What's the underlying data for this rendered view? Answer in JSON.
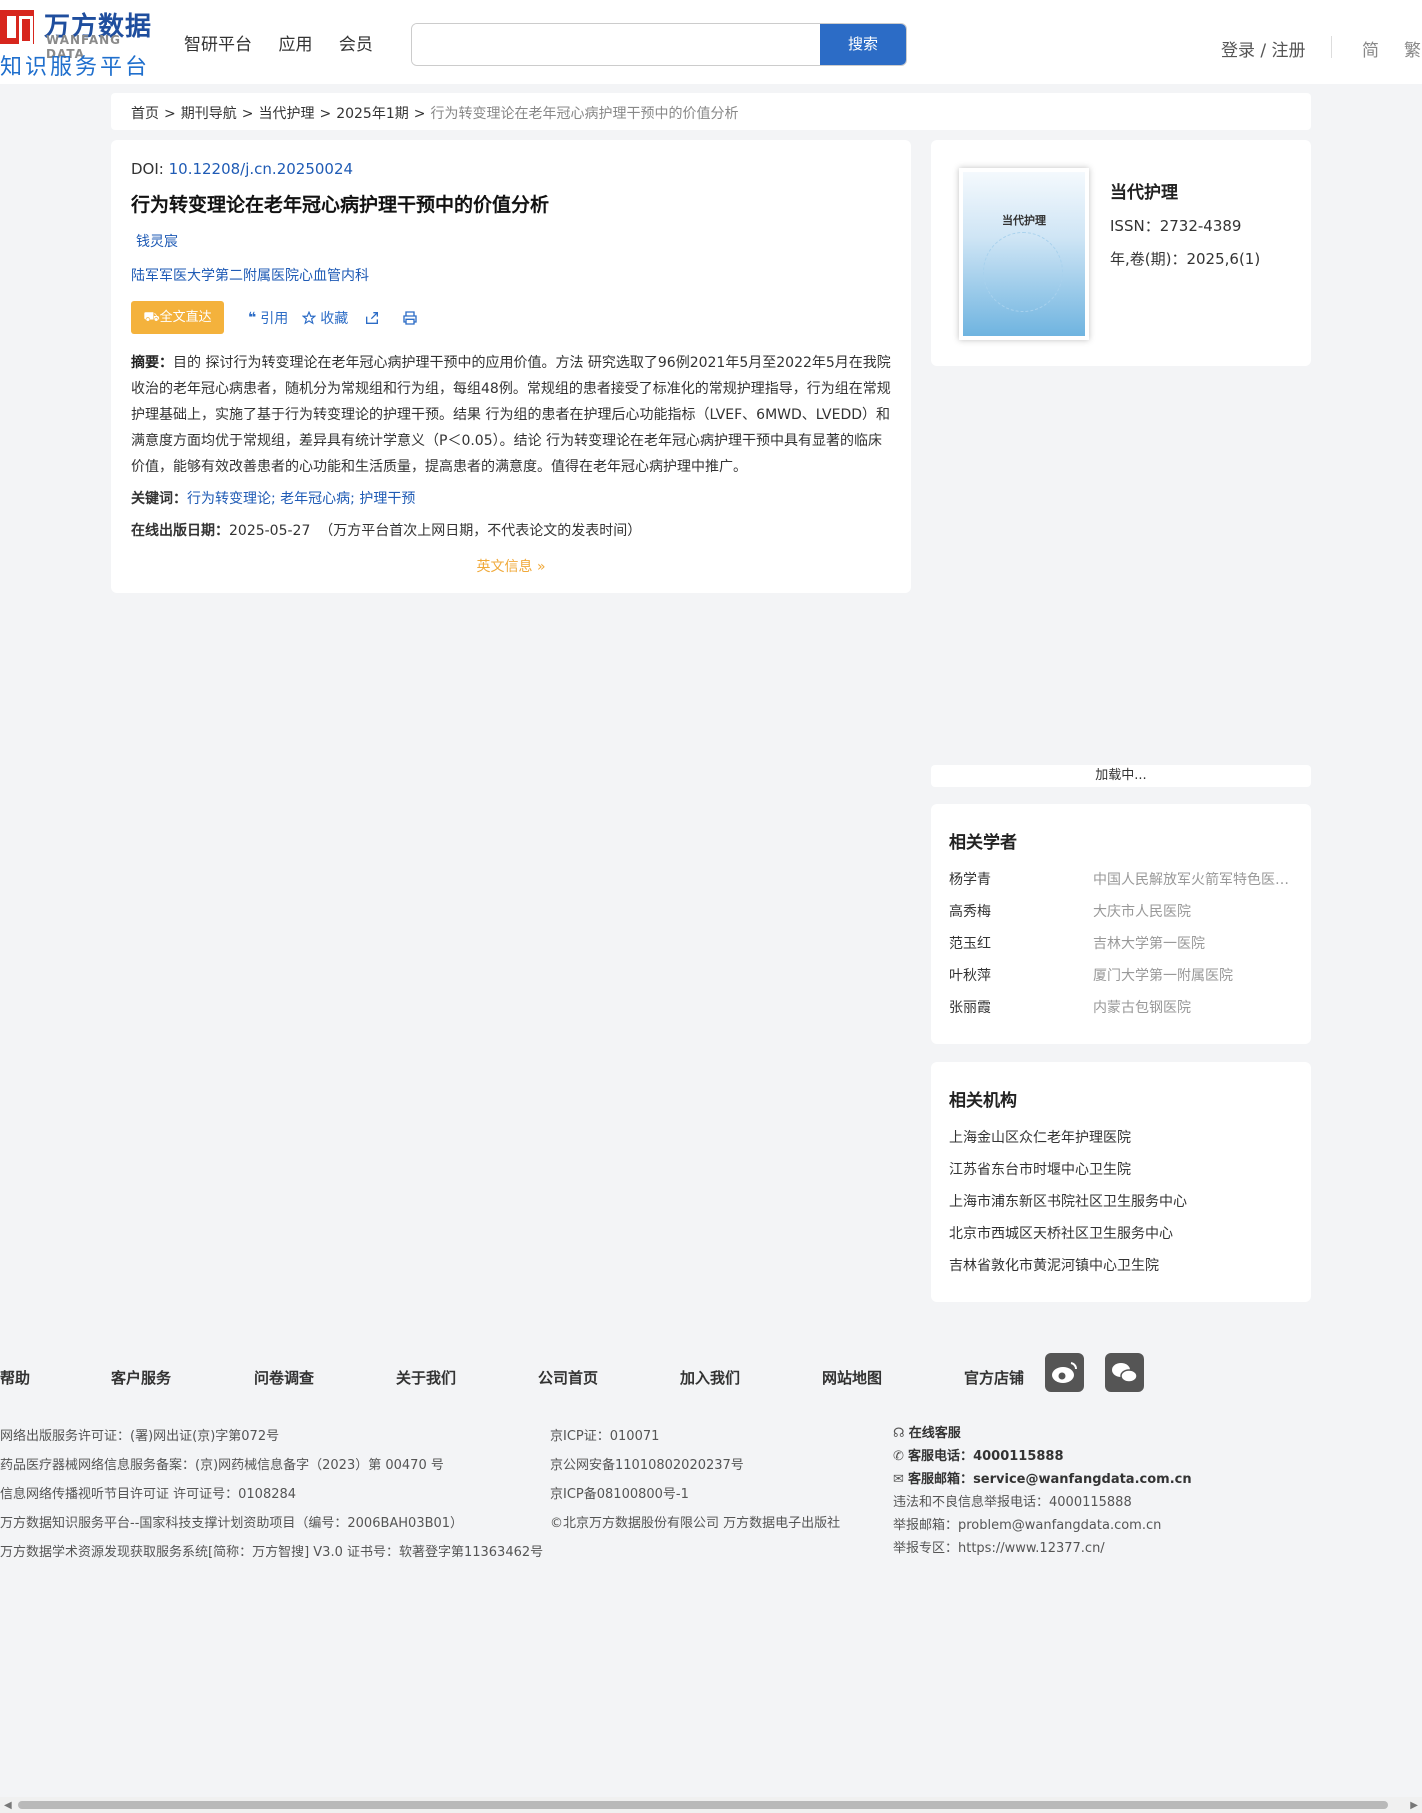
{
  "header": {
    "logo_cn": "万方数据",
    "logo_en": "WANFANG DATA",
    "logo_sub": "知识服务平台",
    "nav": [
      "智研平台",
      "应用",
      "会员"
    ],
    "search_placeholder": "",
    "search_button": "搜索",
    "login": "登录 / 注册",
    "lang_simplified": "简",
    "lang_traditional": "繁"
  },
  "breadcrumb": {
    "items": [
      "首页",
      "期刊导航",
      "当代护理",
      "2025年1期"
    ],
    "current": "行为转变理论在老年冠心病护理干预中的价值分析"
  },
  "article": {
    "doi_label": "DOI: ",
    "doi": "10.12208/j.cn.20250024",
    "title": "行为转变理论在老年冠心病护理干预中的价值分析",
    "author": "钱灵宸",
    "org": "陆军军医大学第二附属医院心血管内科",
    "fulltext_button": "全文直达",
    "cite": "引用",
    "favorite": "收藏",
    "abstract_label": "摘要：",
    "abstract": "目的 探讨行为转变理论在老年冠心病护理干预中的应用价值。方法 研究选取了96例2021年5月至2022年5月在我院收治的老年冠心病患者，随机分为常规组和行为组，每组48例。常规组的患者接受了标准化的常规护理指导，行为组在常规护理基础上，实施了基于行为转变理论的护理干预。结果 行为组的患者在护理后心功能指标（LVEF、6MWD、LVEDD）和满意度方面均优于常规组，差异具有统计学意义（P＜0.05）。结论 行为转变理论在老年冠心病护理干预中具有显著的临床价值，能够有效改善患者的心功能和生活质量，提高患者的满意度。值得在老年冠心病护理中推广。",
    "keywords_label": "关键词：",
    "keywords": [
      "行为转变理论;",
      "老年冠心病;",
      "护理干预"
    ],
    "pubdate_label": "在线出版日期：",
    "pubdate": "2025-05-27",
    "pubdate_note": "（万方平台首次上网日期，不代表论文的发表时间）",
    "english_info": "英文信息"
  },
  "journal": {
    "cover_title": "当代护理",
    "name": "当代护理",
    "issn": "ISSN：2732-4389",
    "year_vol": "年,卷(期)：2025,6(1)"
  },
  "loading": "加载中...",
  "scholars": {
    "title": "相关学者",
    "items": [
      {
        "name": "杨学青",
        "org": "中国人民解放军火箭军特色医学中心"
      },
      {
        "name": "高秀梅",
        "org": "大庆市人民医院"
      },
      {
        "name": "范玉红",
        "org": "吉林大学第一医院"
      },
      {
        "name": "叶秋萍",
        "org": "厦门大学第一附属医院"
      },
      {
        "name": "张丽霞",
        "org": "内蒙古包钢医院"
      }
    ]
  },
  "institutions": {
    "title": "相关机构",
    "items": [
      "上海金山区众仁老年护理医院",
      "江苏省东台市时堰中心卫生院",
      "上海市浦东新区书院社区卫生服务中心",
      "北京市西城区天桥社区卫生服务中心",
      "吉林省敦化市黄泥河镇中心卫生院"
    ]
  },
  "footer": {
    "links": [
      "帮助",
      "客户服务",
      "问卷调查",
      "关于我们",
      "公司首页",
      "加入我们",
      "网站地图",
      "官方店铺"
    ],
    "col1": [
      "网络出版服务许可证：(署)网出证(京)字第072号",
      "药品医疗器械网络信息服务备案：(京)网药械信息备字（2023）第 00470 号",
      "信息网络传播视听节目许可证 许可证号：0108284",
      "万方数据知识服务平台--国家科技支撑计划资助项目（编号：2006BAH03B01）",
      "万方数据学术资源发现获取服务系统[简称：万方智搜] V3.0 证书号：软著登字第11363462号"
    ],
    "col2": [
      "京ICP证：010071",
      "京公网安备11010802020237号",
      "京ICP备08100800号-1",
      "©北京万方数据股份有限公司 万方数据电子出版社"
    ],
    "online_service": "在线客服",
    "phone_label": "客服电话：",
    "phone": "4000115888",
    "email_label": "客服邮箱：",
    "email": "service@wanfangdata.com.cn",
    "report_phone": "违法和不良信息举报电话：4000115888",
    "report_email": "举报邮箱：problem@wanfangdata.com.cn",
    "report_zone": "举报专区：https://www.12377.cn/"
  }
}
